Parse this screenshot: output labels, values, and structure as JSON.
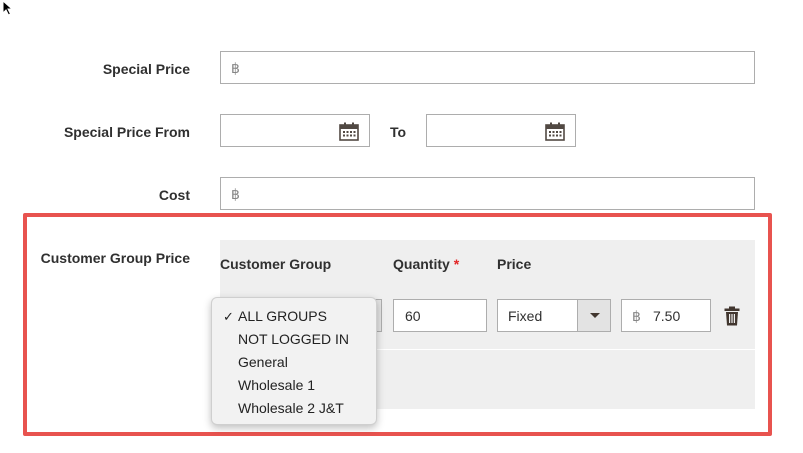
{
  "form": {
    "special_price": {
      "label": "Special Price",
      "currency": "฿",
      "value": ""
    },
    "special_price_from": {
      "label": "Special Price From",
      "from_value": "",
      "to_label": "To",
      "to_value": ""
    },
    "cost": {
      "label": "Cost",
      "currency": "฿",
      "value": ""
    }
  },
  "customer_group_price": {
    "label": "Customer Group Price",
    "columns": {
      "customer_group": "Customer Group",
      "quantity": "Quantity",
      "quantity_required": "*",
      "price": "Price"
    },
    "row": {
      "quantity": "60",
      "price_type": "Fixed",
      "currency": "฿",
      "price": "7.50"
    },
    "dropdown": {
      "options": [
        "ALL GROUPS",
        "NOT LOGGED IN",
        "General",
        "Wholesale 1",
        "Wholesale 2 J&T"
      ],
      "selected_mark": "✓"
    }
  },
  "icons": {
    "calendar": "calendar-icon",
    "trash": "trash-icon",
    "cursor": "cursor-icon",
    "chevron": "chevron-down-icon"
  },
  "colors": {
    "highlight_border": "#e8534f",
    "required": "#e22626",
    "grid_bg": "#efefef"
  }
}
